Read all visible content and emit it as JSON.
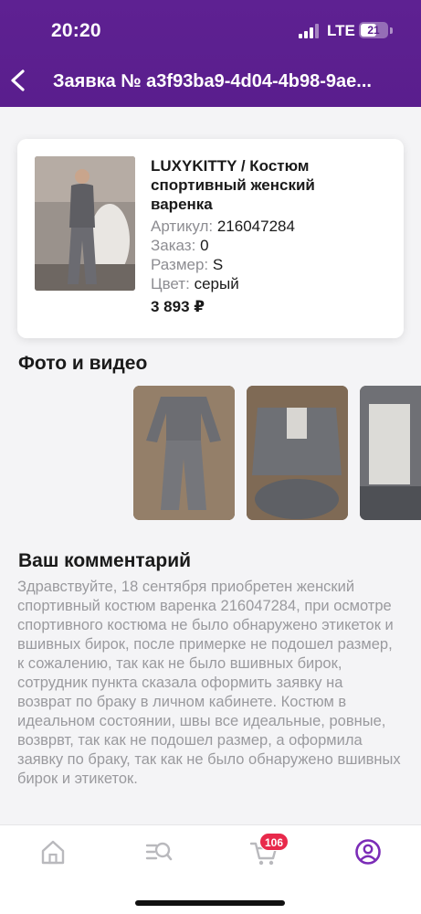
{
  "status_bar": {
    "time": "20:20",
    "network": "LTE",
    "battery": "21"
  },
  "header": {
    "title": "Заявка № a3f93ba9-4d04-4b98-9ae..."
  },
  "product": {
    "title": "LUXYKITTY / Костюм спортивный женский варенка",
    "article_label": "Артикул:",
    "article_value": "216047284",
    "order_label": "Заказ:",
    "order_value": "0",
    "size_label": "Размер:",
    "size_value": "S",
    "color_label": "Цвет:",
    "color_value": "серый",
    "price": "3 893 ₽"
  },
  "media": {
    "title": "Фото и видео",
    "thumbnails": [
      "photo-tracksuit-flatlay",
      "photo-tracksuit-folded",
      "photo-jacket-lining"
    ]
  },
  "comment": {
    "title": "Ваш комментарий",
    "text": "Здравствуйте, 18 сентября приобретен женский спортивный костюм варенка 216047284, при осмотре спортивного костюма не было обнаружено этикеток и вшивных бирок, после примерке не подошел размер, к сожалению, так как не было вшивных бирок, сотрудник пункта сказала оформить заявку на возврат по браку в личном кабинете.  Костюм в идеальном состоянии, швы все идеальные, ровные, возврвт, так как не подошел размер, а оформила заявку по браку, так как не было обнаружено вшивных бирок и этикеток."
  },
  "tabbar": {
    "items": [
      "home-icon",
      "catalog-search-icon",
      "cart-icon",
      "profile-icon"
    ],
    "cart_badge": "106",
    "active_color": "#7b2cb7",
    "inactive_color": "#b9b9bd"
  },
  "colors": {
    "brand": "#5a1e8d",
    "badge": "#e8294b"
  }
}
